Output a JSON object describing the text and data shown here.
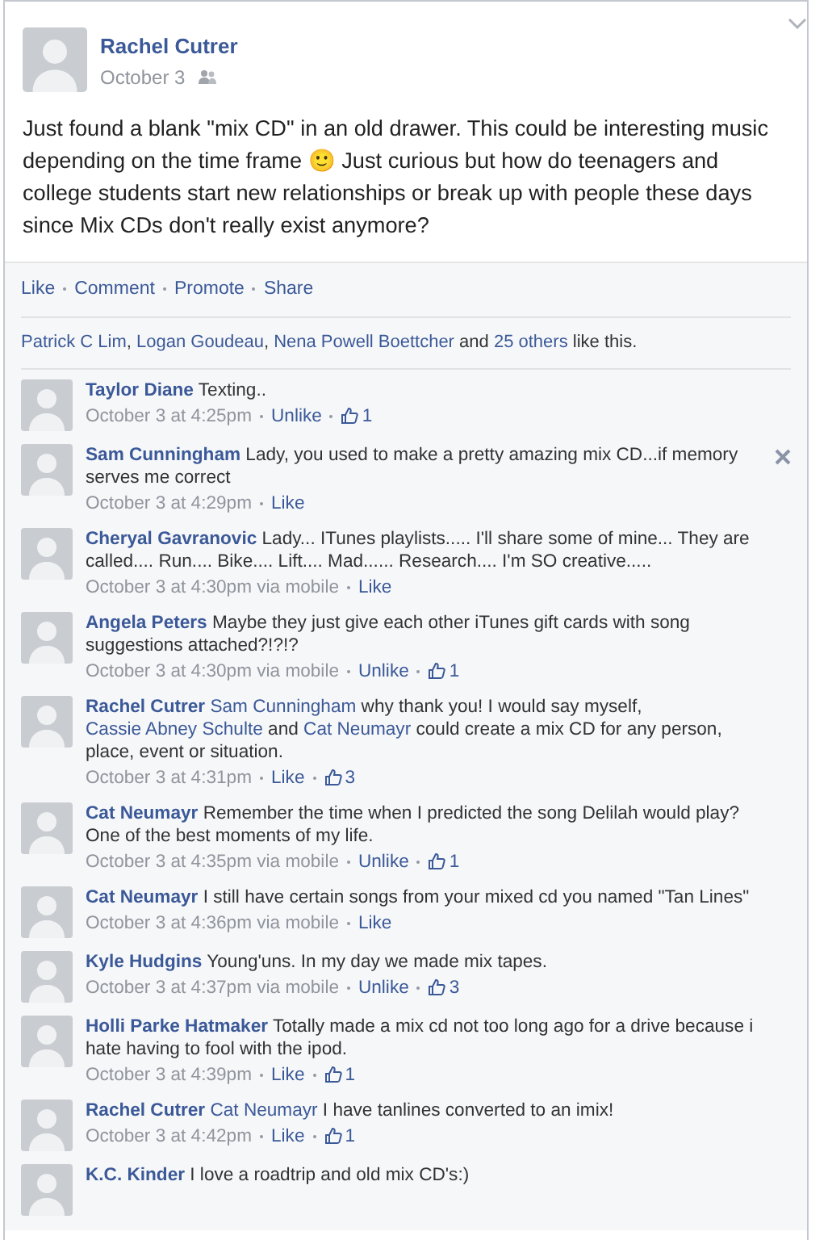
{
  "post": {
    "author": "Rachel Cutrer",
    "date": "October 3",
    "text": "Just found a blank \"mix CD\" in an old drawer. This could be interesting music depending on the time frame 🙂 Just curious but how do teenagers and college students start new relationships or break up with people these days since Mix CDs don't really exist anymore?"
  },
  "actions": [
    "Like",
    "Comment",
    "Promote",
    "Share"
  ],
  "likes_line": [
    {
      "kind": "link",
      "text": "Patrick C Lim"
    },
    {
      "kind": "text",
      "text": ", "
    },
    {
      "kind": "link",
      "text": "Logan Goudeau"
    },
    {
      "kind": "text",
      "text": ", "
    },
    {
      "kind": "link",
      "text": "Nena Powell Boettcher"
    },
    {
      "kind": "text",
      "text": " and "
    },
    {
      "kind": "link",
      "text": "25 others"
    },
    {
      "kind": "text",
      "text": " like this."
    }
  ],
  "comments": [
    {
      "author": "Taylor Diane",
      "body": [
        {
          "kind": "text",
          "text": "Texting.."
        }
      ],
      "time": "October 3 at 4:25pm",
      "action": "Unlike",
      "likes": "1",
      "show_remove": false
    },
    {
      "author": "Sam Cunningham",
      "body": [
        {
          "kind": "text",
          "text": "Lady, you used to make a pretty amazing mix CD...if memory serves me correct"
        }
      ],
      "time": "October 3 at 4:29pm",
      "action": "Like",
      "show_remove": true
    },
    {
      "author": "Cheryal Gavranovic",
      "body": [
        {
          "kind": "text",
          "text": "Lady... ITunes playlists..... I'll share some of mine... They are called.... Run.... Bike.... Lift.... Mad...... Research.... I'm SO creative....."
        }
      ],
      "time": "October 3 at 4:30pm via mobile",
      "action": "Like",
      "show_remove": false
    },
    {
      "author": "Angela Peters",
      "body": [
        {
          "kind": "text",
          "text": "Maybe they just give each other iTunes gift cards with song suggestions attached?!?!?"
        }
      ],
      "time": "October 3 at 4:30pm via mobile",
      "action": "Unlike",
      "likes": "1",
      "show_remove": false
    },
    {
      "author": "Rachel Cutrer",
      "body": [
        {
          "kind": "mention",
          "text": "Sam Cunningham"
        },
        {
          "kind": "text",
          "text": " why thank you! I would say myself, "
        },
        {
          "kind": "mention",
          "text": "Cassie Abney Schulte"
        },
        {
          "kind": "text",
          "text": " and "
        },
        {
          "kind": "mention",
          "text": "Cat Neumayr"
        },
        {
          "kind": "text",
          "text": " could create a mix CD for any person, place, event or situation."
        }
      ],
      "time": "October 3 at 4:31pm",
      "action": "Like",
      "likes": "3",
      "show_remove": false
    },
    {
      "author": "Cat Neumayr",
      "body": [
        {
          "kind": "text",
          "text": "Remember the time when I predicted the song Delilah would play? One of the best moments of my life."
        }
      ],
      "time": "October 3 at 4:35pm via mobile",
      "action": "Unlike",
      "likes": "1",
      "show_remove": false
    },
    {
      "author": "Cat Neumayr",
      "body": [
        {
          "kind": "text",
          "text": "I still have certain songs from your mixed cd you named \"Tan Lines\""
        }
      ],
      "time": "October 3 at 4:36pm via mobile",
      "action": "Like",
      "show_remove": false
    },
    {
      "author": "Kyle Hudgins",
      "body": [
        {
          "kind": "text",
          "text": "Young'uns. In my day we made mix tapes."
        }
      ],
      "time": "October 3 at 4:37pm via mobile",
      "action": "Unlike",
      "likes": "3",
      "show_remove": false
    },
    {
      "author": "Holli Parke Hatmaker",
      "body": [
        {
          "kind": "text",
          "text": "Totally made a mix cd not too long ago for a drive because i hate having to fool with the ipod."
        }
      ],
      "time": "October 3 at 4:39pm",
      "action": "Like",
      "likes": "1",
      "show_remove": false
    },
    {
      "author": "Rachel Cutrer",
      "body": [
        {
          "kind": "mention",
          "text": "Cat Neumayr"
        },
        {
          "kind": "text",
          "text": " I have tanlines converted to an imix!"
        }
      ],
      "time": "October 3 at 4:42pm",
      "action": "Like",
      "likes": "1",
      "show_remove": false
    },
    {
      "author": "K.C. Kinder",
      "body": [
        {
          "kind": "text",
          "text": "I love a roadtrip and old mix CD's:)"
        }
      ],
      "show_remove": false
    }
  ]
}
